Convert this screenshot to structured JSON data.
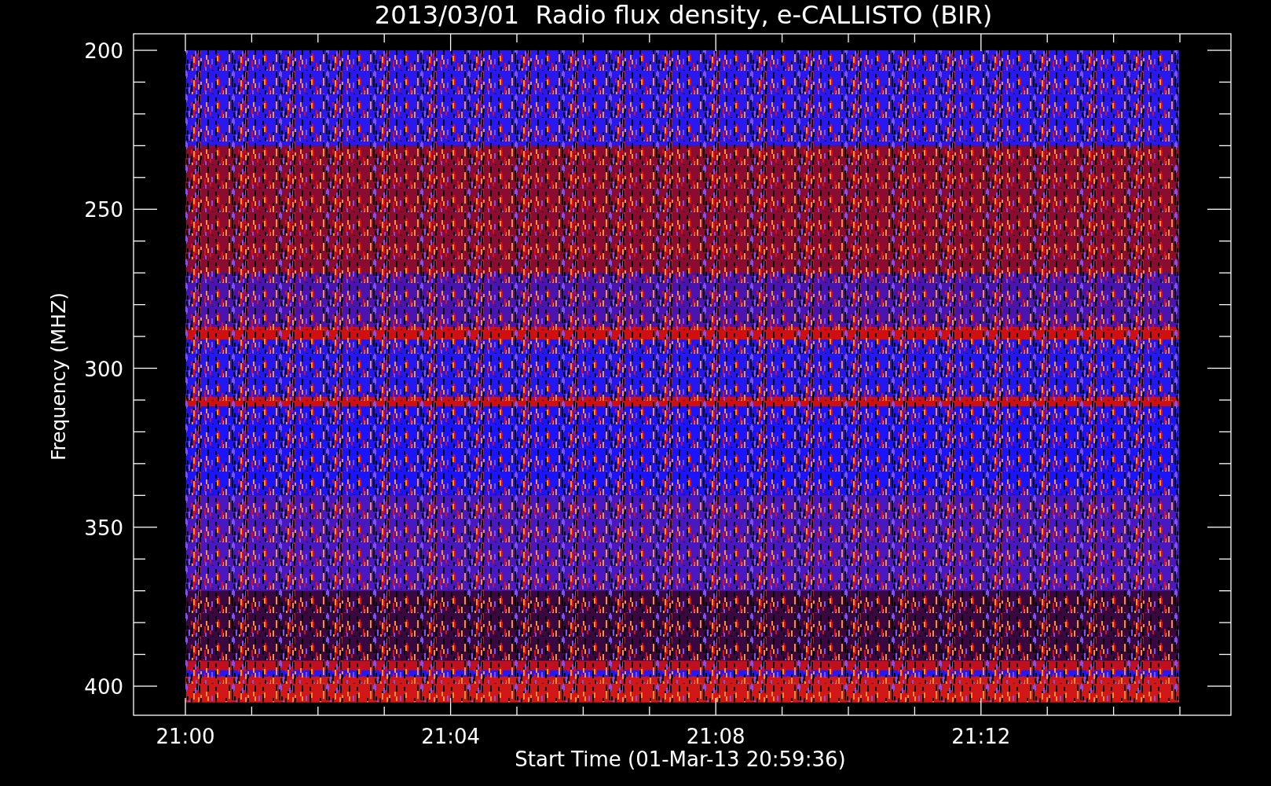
{
  "title": "2013/03/01  Radio flux density, e-CALLISTO (BIR)",
  "y_axis": {
    "label": "Frequency (MHZ)",
    "ticks": [
      "200",
      "250",
      "300",
      "350",
      "400"
    ]
  },
  "x_axis": {
    "label": "Start Time (01-Mar-13 20:59:36)",
    "ticks": [
      "21:00",
      "21:04",
      "21:08",
      "21:12"
    ]
  }
}
